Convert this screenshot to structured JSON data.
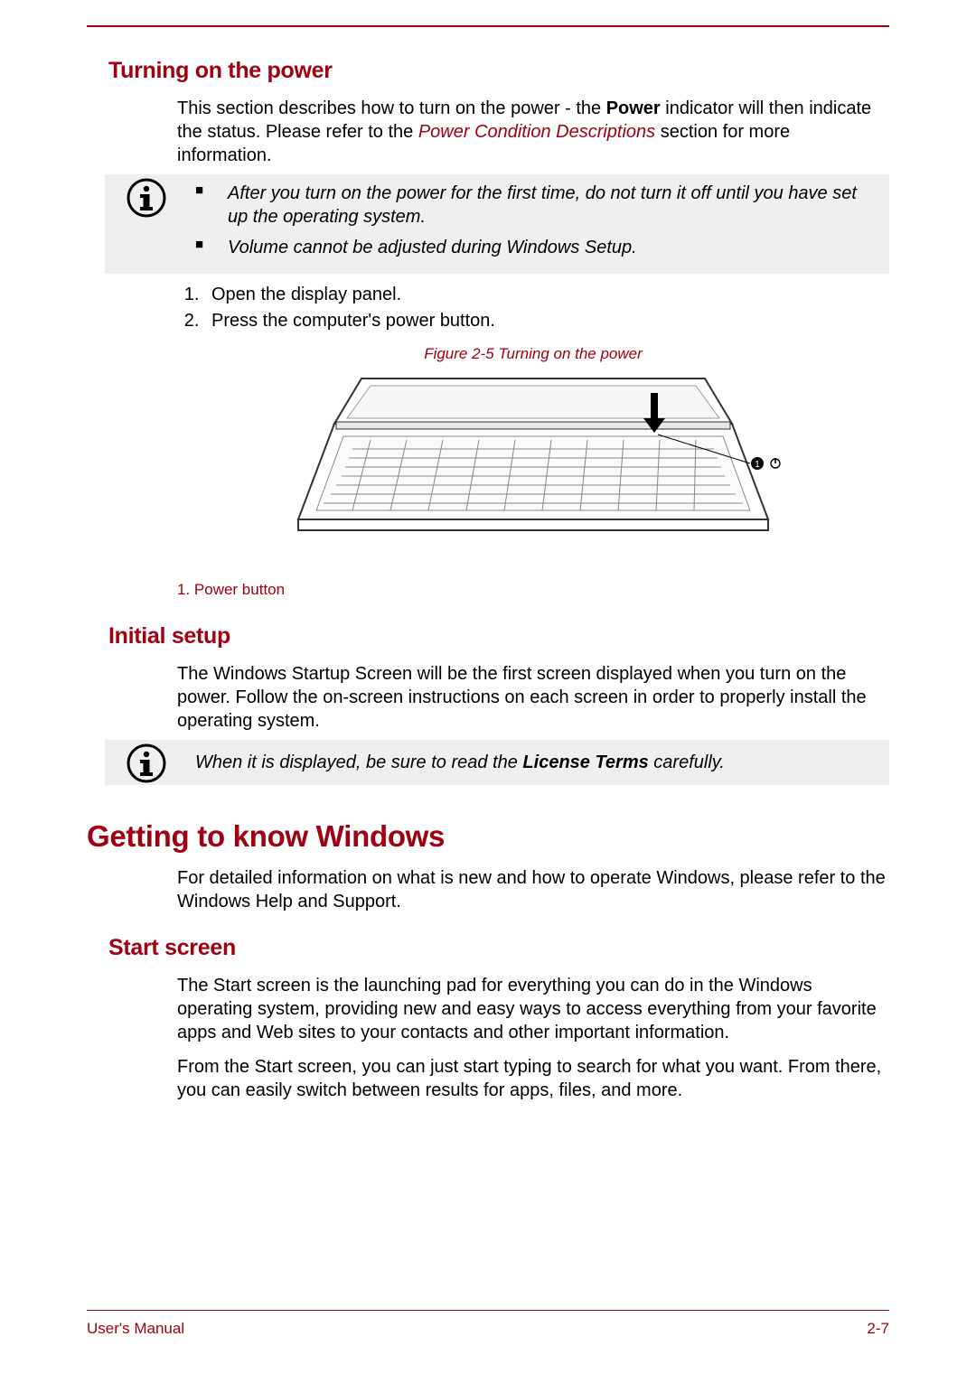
{
  "section1": {
    "heading": "Turning on the power",
    "intro_pre": "This section describes how to turn on the power - the ",
    "intro_bold": "Power",
    "intro_mid": " indicator will then indicate the status. Please refer to the ",
    "intro_link": "Power Condition Descriptions",
    "intro_post": " section for more information.",
    "note": {
      "items": [
        "After you turn on the power for the first time, do not turn it off until you have set up the operating system.",
        "Volume cannot be adjusted during Windows Setup."
      ]
    },
    "steps": [
      "Open the display panel.",
      "Press the computer's power button."
    ],
    "figure_caption": "Figure 2-5 Turning on the power",
    "figure_callout": "1",
    "legend": "1. Power button"
  },
  "section2": {
    "heading": "Initial setup",
    "body": "The Windows Startup Screen will be the first screen displayed when you turn on the power. Follow the on-screen instructions on each screen in order to properly install the operating system.",
    "note_pre": "When it is displayed, be sure to read the ",
    "note_bold": "License Terms",
    "note_post": " carefully."
  },
  "section3": {
    "heading": "Getting to know Windows",
    "body": "For detailed information on what is new and how to operate Windows, please refer to the Windows Help and Support."
  },
  "section4": {
    "heading": "Start screen",
    "p1": "The Start screen is the launching pad for everything you can do in the Windows operating system, providing new and easy ways to access everything from your favorite apps and Web sites to your contacts and other important information.",
    "p2": "From the Start screen, you can just start typing to search for what you want. From there, you can easily switch between results for apps, files, and more."
  },
  "footer": {
    "left": "User's Manual",
    "right": "2-7"
  }
}
